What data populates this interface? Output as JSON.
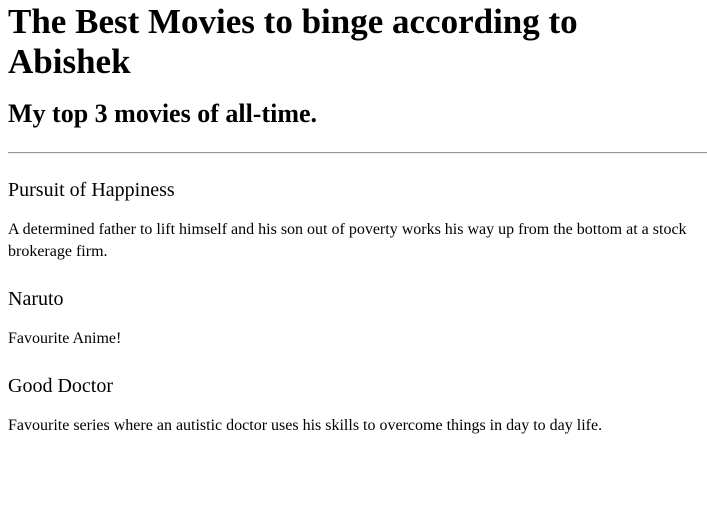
{
  "page": {
    "title": "The Best Movies to binge according to Abishek",
    "subtitle": "My top 3 movies of all-time."
  },
  "movies": [
    {
      "title": "Pursuit of Happiness",
      "description": "A determined father to lift himself and his son out of poverty works his way up from the bottom at a stock brokerage firm."
    },
    {
      "title": "Naruto",
      "description": "Favourite Anime!"
    },
    {
      "title": "Good Doctor",
      "description": "Favourite series where an autistic doctor uses his skills to overcome things in day to day life."
    }
  ]
}
